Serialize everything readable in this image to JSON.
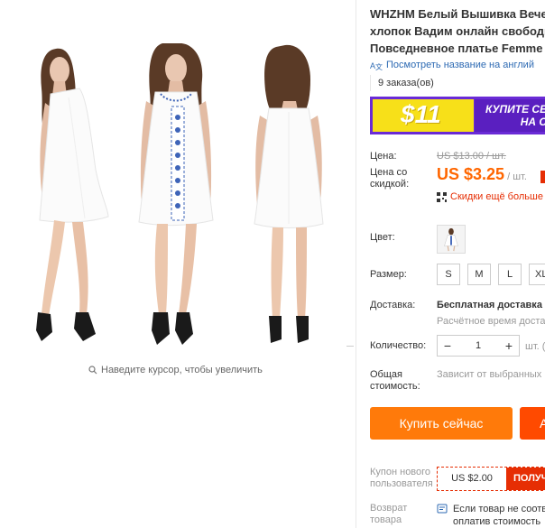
{
  "product": {
    "title_lines": [
      "WHZHM Белый Вышивка Вечер",
      "хлопок Вадим онлайн свободн",
      "Повседневное платье Femme"
    ],
    "translate_link": "Посмотреть название на англий",
    "orders": "9 заказа(ов)"
  },
  "banner": {
    "amount": "$11",
    "text_line1": "КУПИТЕ СЕ",
    "text_line2": "НА С"
  },
  "price": {
    "label": "Цена:",
    "old": "US $13.00 / шт.",
    "discount_label_1": "Цена со",
    "discount_label_2": "скидкой:",
    "new_value": "US $3.25",
    "new_unit": "/ шт.",
    "more_discounts": "Скидки ещё больше"
  },
  "options": {
    "color_label": "Цвет:",
    "size_label": "Размер:",
    "sizes": [
      "S",
      "M",
      "L",
      "XL"
    ]
  },
  "shipping": {
    "label": "Доставка:",
    "title": "Бесплатная доставка н",
    "subtitle": "Расчётное время доста"
  },
  "quantity": {
    "label": "Количество:",
    "value": "1",
    "minus": "−",
    "plus": "+",
    "unit": "шт. (6"
  },
  "total": {
    "label_1": "Общая",
    "label_2": "стоимость:",
    "value": "Зависит от выбранных"
  },
  "actions": {
    "buy_now": "Купить сейчас",
    "add_cart": "А"
  },
  "coupon": {
    "label_1": "Купон нового",
    "label_2": "пользователя",
    "amount": "US $2.00",
    "get": "ПОЛУЧ"
  },
  "returns": {
    "label_1": "Возврат",
    "label_2": "товара",
    "line1": "Если товар не соотв",
    "line2": "оплатив стоимость"
  },
  "gallery": {
    "zoom_hint": "Наведите курсор, чтобы увеличить"
  },
  "colors": {
    "accent": "#ff7a0a",
    "price": "#ff6600",
    "sale_red": "#e62e04",
    "link": "#2d6ab3",
    "banner_purple": "#6a2bd6",
    "banner_yellow": "#f7e019"
  }
}
